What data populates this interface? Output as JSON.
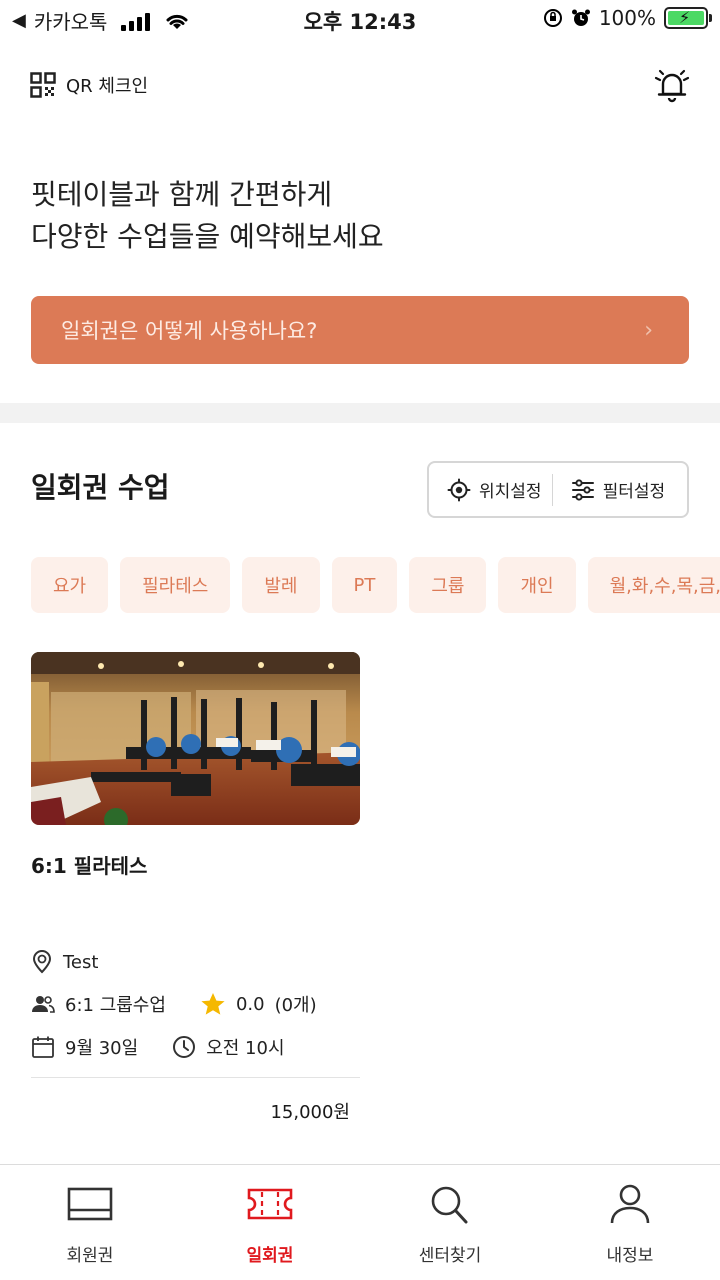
{
  "status_bar": {
    "back_app": "카카오톡",
    "time": "오후 12:43",
    "battery": "100%"
  },
  "header": {
    "qr_label": "QR 체크인"
  },
  "intro": {
    "line1": "핏테이블과 함께 간편하게",
    "line2": "다양한 수업들을 예약해보세요"
  },
  "guide_button": {
    "label": "일회권은 어떻게 사용하나요?"
  },
  "section": {
    "title": "일회권 수업",
    "location_label": "위치설정",
    "filter_label": "필터설정"
  },
  "chips": [
    "요가",
    "필라테스",
    "발레",
    "PT",
    "그룹",
    "개인",
    "월,화,수,목,금,토,일"
  ],
  "card": {
    "title": "6:1 필라테스",
    "location": "Test",
    "class_type": "6:1 그룹수업",
    "rating": "0.0",
    "review_count": "(0개)",
    "date": "9월 30일",
    "time": "오전 10시",
    "price": "15,000원"
  },
  "bottom_nav": {
    "items": [
      {
        "label": "회원권",
        "icon": "card-icon",
        "active": false
      },
      {
        "label": "일회권",
        "icon": "ticket-icon",
        "active": true
      },
      {
        "label": "센터찾기",
        "icon": "search-icon",
        "active": false
      },
      {
        "label": "내정보",
        "icon": "person-icon",
        "active": false
      }
    ]
  },
  "colors": {
    "accent": "#dc7a56",
    "chip_bg": "#fdf0ea",
    "active_nav": "#e0191e",
    "star": "#f5b800"
  }
}
